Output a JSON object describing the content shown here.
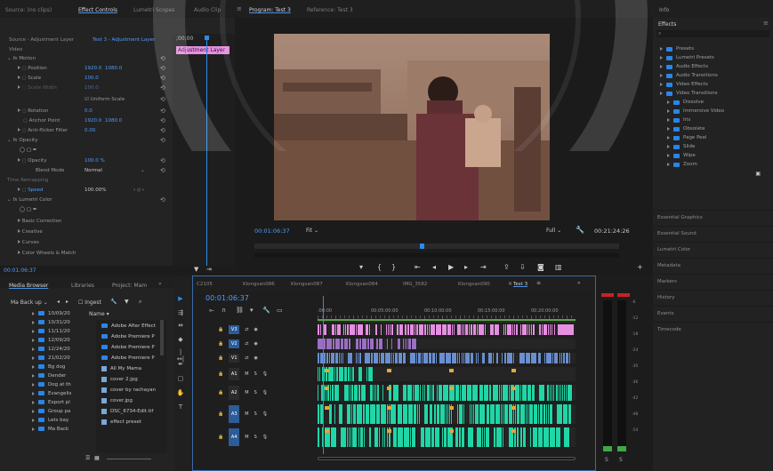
{
  "top_tabs": {
    "source": "Source: (no clips)",
    "effect_controls": "Effect Controls",
    "lumetri_scopes": "Lumetri Scopes",
    "audio_clip": "Audio Clip",
    "program": "Program: Test 3",
    "reference": "Reference: Test 3",
    "info": "Info"
  },
  "effect_controls": {
    "source_label": "Source - Adjustment Layer",
    "clip_label": "Test 3 - Adjustment Layer",
    "timecode_start": ";00;00",
    "clip_name": "Adjustment Layer",
    "video_header": "Video",
    "motion": "Motion",
    "position_label": "Position",
    "position_x": "1920.0",
    "position_y": "1080.0",
    "scale_label": "Scale",
    "scale_value": "100.0",
    "scale_width_label": "Scale Width",
    "scale_width_value": "100.0",
    "uniform_scale": "Uniform Scale",
    "rotation_label": "Rotation",
    "rotation_value": "0.0",
    "anchor_label": "Anchor Point",
    "anchor_x": "1920.0",
    "anchor_y": "1080.0",
    "flicker_label": "Anti-flicker Filter",
    "flicker_value": "0.00",
    "opacity_header": "Opacity",
    "opacity_label": "Opacity",
    "opacity_value": "100.0 %",
    "blend_label": "Blend Mode",
    "blend_value": "Normal",
    "time_remap": "Time Remapping",
    "speed_label": "Speed",
    "speed_value": "100.00%",
    "lumetri": "Lumetri Color",
    "basic_correction": "Basic Correction",
    "creative": "Creative",
    "curves": "Curves",
    "color_wheels": "Color Wheels & Match",
    "footer_timecode": "00:01:06:37"
  },
  "program": {
    "timecode": "00:01:06:37",
    "fit": "Fit",
    "quality": "Full",
    "duration": "00:21:24:26"
  },
  "effects_panel": {
    "title": "Effects",
    "items": [
      {
        "label": "Presets",
        "level": 0
      },
      {
        "label": "Lumetri Presets",
        "level": 0
      },
      {
        "label": "Audio Effects",
        "level": 0
      },
      {
        "label": "Audio Transitions",
        "level": 0
      },
      {
        "label": "Video Effects",
        "level": 0
      },
      {
        "label": "Video Transitions",
        "level": 0
      },
      {
        "label": "Dissolve",
        "level": 1
      },
      {
        "label": "Immersive Video",
        "level": 1
      },
      {
        "label": "Iris",
        "level": 1
      },
      {
        "label": "Obsolete",
        "level": 1
      },
      {
        "label": "Page Peel",
        "level": 1
      },
      {
        "label": "Slide",
        "level": 1
      },
      {
        "label": "Wipe",
        "level": 1
      },
      {
        "label": "Zoom",
        "level": 1
      }
    ],
    "sections": [
      "Essential Graphics",
      "Essential Sound",
      "Lumetri Color",
      "Metadata",
      "Markers",
      "History",
      "Events",
      "Timecode"
    ]
  },
  "media_browser": {
    "tabs": [
      "Media Browser",
      "Libraries",
      "Project: Mam"
    ],
    "location": "Ma Back up",
    "ingest": "Ingest",
    "name_header": "Name",
    "folders": [
      "10/09/20",
      "10/31/20",
      "11/11/20",
      "12/09/20",
      "12/24/20",
      "21/02/20",
      "Bg dog",
      "Dender",
      "Dog at th",
      "Evangelis",
      "Export pl",
      "Group pa",
      "Lets bay",
      "Ma Back"
    ],
    "files": [
      "Adobe After Effect",
      "Adobe Premiere P",
      "Adobe Premiere P",
      "Adobe Premiere P",
      "All My Mama",
      "cover 2.jpg",
      "cover by rachayan",
      "cover.jpg",
      "DSC_6734-Edit.tif",
      "effect preset"
    ]
  },
  "timeline": {
    "tabs": [
      "C2105",
      "Klongsan086",
      "Klongsan087",
      "Klongsan084",
      "IMG_3582",
      "Klongsan090",
      "Test 3"
    ],
    "timecode": "00:01:06:37",
    "ruler": [
      ":00:00",
      "00:05:00:00",
      "00:10:00:00",
      "00:15:00:00",
      "00:20:00:00"
    ],
    "tracks": [
      {
        "id": "V3",
        "type": "video"
      },
      {
        "id": "V2",
        "type": "video"
      },
      {
        "id": "V1",
        "type": "video"
      },
      {
        "id": "A1",
        "type": "audio"
      },
      {
        "id": "A2",
        "type": "audio"
      },
      {
        "id": "A3",
        "type": "audio"
      },
      {
        "id": "A4",
        "type": "audio"
      }
    ],
    "meter_labels": [
      "-6",
      "-12",
      "-18",
      "-24",
      "-30",
      "-36",
      "-42",
      "-48",
      "-54"
    ],
    "meter_s": "S"
  },
  "colors": {
    "accent_blue": "#2d8ceb",
    "pink_clip": "#e48fe0",
    "video_blue": "#6a8fd1",
    "audio_green": "#1fd6a6",
    "panel_bg": "#232323"
  }
}
